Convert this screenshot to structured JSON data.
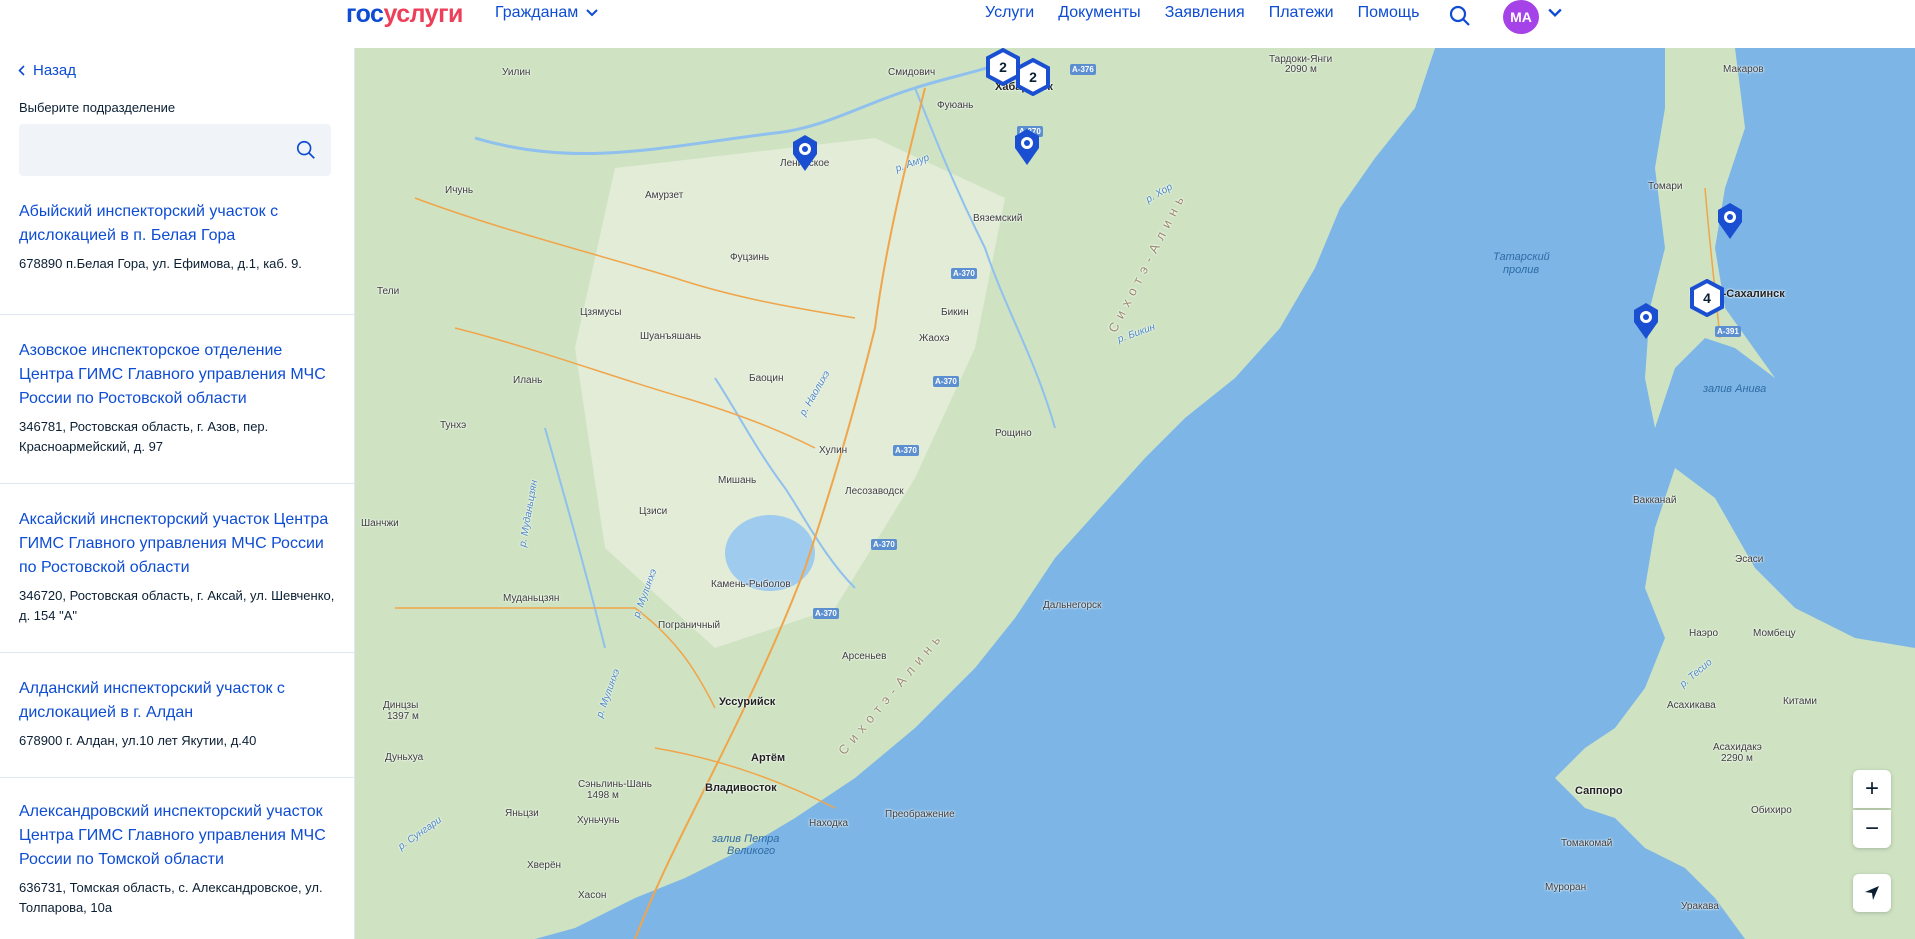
{
  "header": {
    "logo_part1": "гос",
    "logo_part2": "услуги",
    "citizens": "Гражданам",
    "nav": [
      "Услуги",
      "Документы",
      "Заявления",
      "Платежи",
      "Помощь"
    ],
    "avatar": "МА",
    "colors": {
      "brand_blue": "#0d4cd3",
      "brand_red": "#ee3f58",
      "avatar": "#a643e8"
    }
  },
  "sidebar": {
    "back": "Назад",
    "select_label": "Выберите подразделение",
    "search_value": "",
    "items": [
      {
        "title": "Абыйский инспекторский участок с дислокацией в п. Белая Гора",
        "address": "678890 п.Белая Гора, ул. Ефимова, д.1, каб. 9."
      },
      {
        "title": "Азовское инспекторское отделение Центра ГИМС Главного управления МЧС России по Ростовской области",
        "address": "346781, Ростовская область, г. Азов, пер. Красноармейский, д. 97"
      },
      {
        "title": "Аксайский инспекторский участок Центра ГИМС Главного управления МЧС России по Ростовской области",
        "address": "346720, Ростовская область, г. Аксай, ул. Шевченко, д. 154 \"А\""
      },
      {
        "title": "Алданский инспекторский участок с дислокацией в г. Алдан",
        "address": "678900 г. Алдан, ул.10 лет Якутии, д.40"
      },
      {
        "title": "Александровский инспекторский участок Центра ГИМС Главного управления МЧС России по Томской области",
        "address": "636731, Томская область, с. Александровское, ул. Толпарова, 10а"
      }
    ]
  },
  "map": {
    "clusters": [
      "2",
      "2",
      "4"
    ],
    "labels": {
      "uilin": "Уилин",
      "smidovich": "Смидович",
      "khabarovsk": "Хабаровск",
      "fuyuan": "Фуюань",
      "tardoki": "Тардоки-Янги",
      "tardoki_h": "2090 м",
      "makarov": "Макаров",
      "lenin": "Ленинское",
      "amurzet": "Амурзет",
      "ichun": "Ичунь",
      "vyazemsky": "Вяземский",
      "tomari": "Томари",
      "fuczin": "Фуцзинь",
      "tatar": "Татарский",
      "tatar2": "пролив",
      "teli": "Тели",
      "yuzhno": "Южно-Сахалинск",
      "czyamusy": "Цзямусы",
      "shuanyashan": "Шуанъяшань",
      "bikin": "Бикин",
      "zhaokhe": "Жаохэ",
      "ilan": "Илань",
      "baocin": "Баоцин",
      "aniva": "залив Анива",
      "tunkhe": "Тунхэ",
      "roshino": "Рощино",
      "hulin": "Хулин",
      "mishan": "Мишань",
      "lesozavodsk": "Лесозаводск",
      "vakkanai": "Вакканай",
      "shanchzhi": "Шанчжи",
      "czisi": "Цзиси",
      "esasi": "Эсаси",
      "kamen": "Камень-Рыболов",
      "mudanczyan": "Муданьцзян",
      "pogranichny": "Пограничный",
      "dalnegorsk": "Дальнегорск",
      "naero": "Наэро",
      "mombecu": "Момбецу",
      "arsenyev": "Арсеньев",
      "dinczy": "Динцзы",
      "dinczy_h": "1397 м",
      "ussuriysk": "Уссурийск",
      "asahikava": "Асахикава",
      "kitami": "Китами",
      "asahidake": "Асахидакэ",
      "asahidake_h": "2290 м",
      "dunkhua": "Дуньхуа",
      "artem": "Артём",
      "sanjilin": "Сэньлинь-Шань",
      "sanjilin_h": "1498 м",
      "vladivostok": "Владивосток",
      "sapporo": "Саппоро",
      "obihiro": "Обихиро",
      "preobr": "Преображение",
      "yancz": "Яньцзи",
      "hunchun": "Хуньчунь",
      "nahodka": "Находка",
      "tomakomai": "Томакомай",
      "petra": "залив Петра",
      "velikogo": "Великого",
      "hveren": "Хверён",
      "muroran": "Муроран",
      "hason": "Хасон",
      "urakava": "Уракава",
      "sikhote": "Сихотэ-Алинь",
      "sikhote2": "Сихотэ-Алинь",
      "r_amur": "р. Амур",
      "r_khor": "р. Хор",
      "r_bikin": "р. Бикин",
      "r_naoli": "р. Наолихэ",
      "r_mudan": "р. Муданьцзян",
      "r_mulin": "р. Мулинхэ",
      "r_mulin2": "р. Мулинхэ",
      "r_sungari": "р. Сунгари",
      "r_tesio": "р. Тесио"
    },
    "roads": [
      "А-376",
      "А-370",
      "А-370",
      "А-370",
      "А-370",
      "А-370",
      "А-370",
      "А-391"
    ],
    "zoom_in": "+",
    "zoom_out": "−"
  }
}
